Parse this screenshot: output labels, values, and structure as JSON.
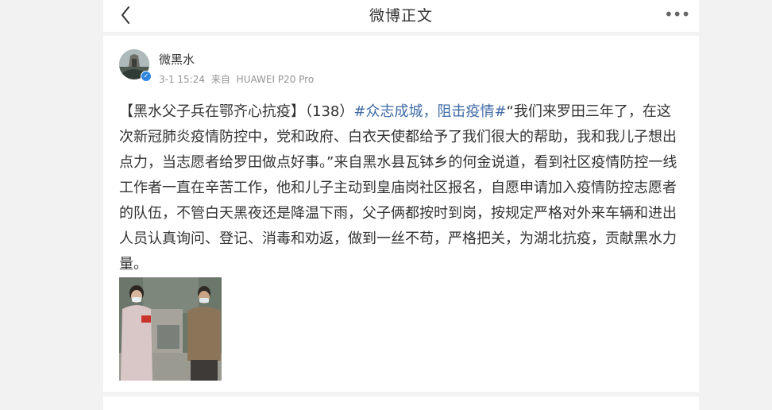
{
  "header": {
    "back_icon": "chevron-left-icon",
    "title": "微博正文",
    "more_icon": "more-dots-icon"
  },
  "post": {
    "author": "微黑水",
    "verified_icon": "verified-check-icon",
    "date": "3-1 15:24",
    "source_prefix": "来自",
    "source": "HUAWEI P20 Pro",
    "text_prefix": "【黑水父子兵在鄂齐心抗疫】（138）",
    "hashtag": "#众志成城，阻击疫情#",
    "text_body": "“我们来罗田三年了，在这次新冠肺炎疫情防控中，党和政府、白衣天使都给予了我们很大的帮助，我和我儿子想出点力，当志愿者给罗田做点好事。”来自黑水县瓦钵乡的何金说道，看到社区疫情防控一线工作者一直在辛苦工作，他和儿子主动到皇庙岗社区报名，自愿申请加入疫情防控志愿者的队伍，不管白天黑夜还是降温下雨，父子俩都按时到岗，按规定严格对外来车辆和进出人员认真询问、登记、消毒和劝返，做到一丝不苟，严格把关，为湖北抗疫，贡献黑水力量。"
  },
  "colors": {
    "link": "#3f6aa6",
    "background": "#f2f2f2",
    "card": "#ffffff",
    "meta": "#939393"
  }
}
